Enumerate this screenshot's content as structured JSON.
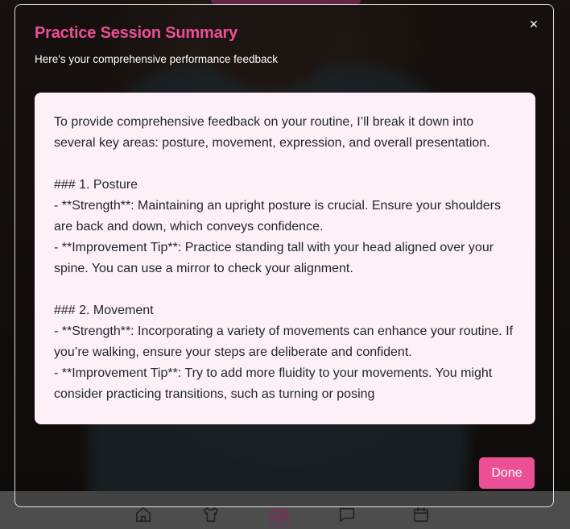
{
  "modal": {
    "title": "Practice Session Summary",
    "subtitle": "Here's your comprehensive performance feedback",
    "close_label": "×",
    "done_label": "Done",
    "feedback_lines": [
      "To provide comprehensive feedback on your routine, I’ll break it down into",
      "several key areas: posture, movement, expression, and overall presentation.",
      "",
      "### 1. Posture",
      "- **Strength**: Maintaining an upright posture is crucial. Ensure your shoulders",
      "are back and down, which conveys confidence.",
      "- **Improvement Tip**: Practice standing tall with your head aligned over your",
      "spine. You can use a mirror to check your alignment.",
      "",
      "### 2. Movement",
      "- **Strength**: Incorporating a variety of movements can enhance your routine. If",
      "you’re walking, ensure your steps are deliberate and confident.",
      "- **Improvement Tip**: Try to add more fluidity to your movements. You might",
      "consider practicing transitions, such as turning or posing"
    ]
  },
  "bottom_nav": {
    "items": [
      {
        "icon": "home-icon"
      },
      {
        "icon": "shirt-icon"
      },
      {
        "icon": "video-camera-icon",
        "active": true
      },
      {
        "icon": "chat-icon"
      },
      {
        "icon": "calendar-icon"
      }
    ]
  },
  "colors": {
    "accent": "#ec4f96",
    "feedback_bg": "#fdf0f6",
    "text": "#1f2430",
    "nav_bg": "#8d8d8f"
  }
}
